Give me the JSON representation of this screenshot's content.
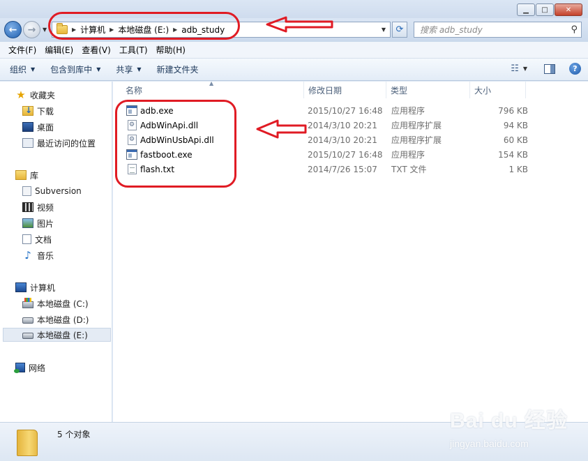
{
  "address": {
    "crumbs": [
      "计算机",
      "本地磁盘 (E:)",
      "adb_study"
    ],
    "search_placeholder": "搜索 adb_study"
  },
  "menubar": [
    "文件(F)",
    "编辑(E)",
    "查看(V)",
    "工具(T)",
    "帮助(H)"
  ],
  "toolbar": {
    "organize": "组织",
    "include_library": "包含到库中",
    "share": "共享",
    "new_folder": "新建文件夹"
  },
  "nav": {
    "favorites": "收藏夹",
    "downloads": "下载",
    "desktop": "桌面",
    "recent": "最近访问的位置",
    "libraries": "库",
    "subversion": "Subversion",
    "videos": "视频",
    "pictures": "图片",
    "documents": "文档",
    "music": "音乐",
    "computer": "计算机",
    "drive_c": "本地磁盘 (C:)",
    "drive_d": "本地磁盘 (D:)",
    "drive_e": "本地磁盘 (E:)",
    "network": "网络"
  },
  "columns": {
    "name": "名称",
    "date": "修改日期",
    "type": "类型",
    "size": "大小"
  },
  "files": [
    {
      "name": "adb.exe",
      "date": "2015/10/27 16:48",
      "type": "应用程序",
      "size": "796 KB",
      "icon": "exe-icon"
    },
    {
      "name": "AdbWinApi.dll",
      "date": "2014/3/10 20:21",
      "type": "应用程序扩展",
      "size": "94 KB",
      "icon": "dll-icon"
    },
    {
      "name": "AdbWinUsbApi.dll",
      "date": "2014/3/10 20:21",
      "type": "应用程序扩展",
      "size": "60 KB",
      "icon": "dll-icon"
    },
    {
      "name": "fastboot.exe",
      "date": "2015/10/27 16:48",
      "type": "应用程序",
      "size": "154 KB",
      "icon": "exe-icon"
    },
    {
      "name": "flash.txt",
      "date": "2014/7/26 15:07",
      "type": "TXT 文件",
      "size": "1 KB",
      "icon": "txt-icon"
    }
  ],
  "status": "5 个对象",
  "watermark": {
    "brand": "Bai du 经验",
    "url": "jingyan.baidu.com"
  },
  "annotation_color": "#e01b24"
}
